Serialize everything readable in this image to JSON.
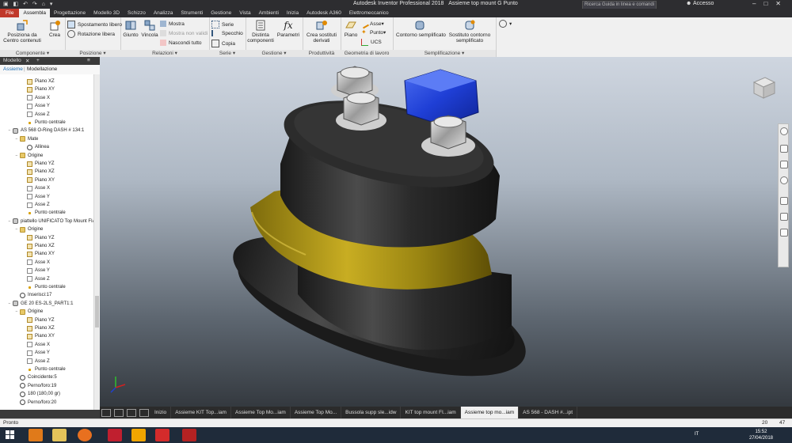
{
  "titlebar": {
    "app_title": "Autodesk Inventor Professional 2018",
    "doc_title": "Assieme top mount G Punto",
    "search_placeholder": "Ricerca Guida in linea e comandi",
    "account": "Accesso"
  },
  "tabs": [
    "File",
    "Assembla",
    "Progettazione",
    "Modello 3D",
    "Schizzo",
    "Analizza",
    "Strumenti",
    "Gestione",
    "Vista",
    "Ambienti",
    "Inizia",
    "Autodesk A360",
    "Elettromeccanico"
  ],
  "ribbon": {
    "componente": {
      "label": "Componente",
      "posiziona": "Posiziona da Centro contenuti",
      "crea": "Crea"
    },
    "posizione": {
      "label": "Posizione",
      "spostamento": "Spostamento libero",
      "rotazione": "Rotazione libera"
    },
    "relazioni": {
      "label": "Relazioni",
      "giunto": "Giunto",
      "vincola": "Vincola",
      "mostra": "Mostra",
      "mostra_non_validi": "Mostra non validi",
      "nascondi": "Nascondi tutto"
    },
    "serie": {
      "label": "Serie",
      "serie": "Serie",
      "specchio": "Specchio",
      "copia": "Copia"
    },
    "gestione": {
      "label": "Gestione",
      "distinta": "Distinta componenti",
      "parametri": "Parametri"
    },
    "produttivita": {
      "label": "Produttività",
      "crea_sostituti": "Crea sostituti derivati"
    },
    "geometria": {
      "label": "Geometria di lavoro",
      "piano": "Piano",
      "asse": "Asse",
      "punto": "Punto",
      "ucs": "UCS"
    },
    "semplificazione": {
      "label": "Semplificazione",
      "contorno": "Contorno semplificato",
      "sostituto": "Sostituto contorno semplificato"
    }
  },
  "browser": {
    "header": "Modello",
    "mode_assieme": "Assieme",
    "mode_modellazione": "Modellazione",
    "tree": [
      {
        "label": "Piano XZ",
        "indent": 3,
        "icon": "plane",
        "toggle": ""
      },
      {
        "label": "Piano XY",
        "indent": 3,
        "icon": "plane",
        "toggle": ""
      },
      {
        "label": "Asse X",
        "indent": 3,
        "icon": "axis",
        "toggle": ""
      },
      {
        "label": "Asse Y",
        "indent": 3,
        "icon": "axis",
        "toggle": ""
      },
      {
        "label": "Asse Z",
        "indent": 3,
        "icon": "axis",
        "toggle": ""
      },
      {
        "label": "Punto centrale",
        "indent": 3,
        "icon": "point",
        "toggle": ""
      },
      {
        "label": "AS 568 O-Ring DASH # 134:1",
        "indent": 1,
        "icon": "part",
        "toggle": "−"
      },
      {
        "label": "Mate",
        "indent": 2,
        "icon": "folder",
        "toggle": "−"
      },
      {
        "label": "Allinea",
        "indent": 3,
        "icon": "mate",
        "toggle": ""
      },
      {
        "label": "Origine",
        "indent": 2,
        "icon": "folder",
        "toggle": "−"
      },
      {
        "label": "Piano YZ",
        "indent": 3,
        "icon": "plane",
        "toggle": ""
      },
      {
        "label": "Piano XZ",
        "indent": 3,
        "icon": "plane",
        "toggle": ""
      },
      {
        "label": "Piano XY",
        "indent": 3,
        "icon": "plane",
        "toggle": ""
      },
      {
        "label": "Asse X",
        "indent": 3,
        "icon": "axis",
        "toggle": ""
      },
      {
        "label": "Asse Y",
        "indent": 3,
        "icon": "axis",
        "toggle": ""
      },
      {
        "label": "Asse Z",
        "indent": 3,
        "icon": "axis",
        "toggle": ""
      },
      {
        "label": "Punto centrale",
        "indent": 3,
        "icon": "point",
        "toggle": ""
      },
      {
        "label": "piattello UNIFICATO Top Mount FIAT G",
        "indent": 1,
        "icon": "part",
        "toggle": "−"
      },
      {
        "label": "Origine",
        "indent": 2,
        "icon": "folder",
        "toggle": "−"
      },
      {
        "label": "Piano YZ",
        "indent": 3,
        "icon": "plane",
        "toggle": ""
      },
      {
        "label": "Piano XZ",
        "indent": 3,
        "icon": "plane",
        "toggle": ""
      },
      {
        "label": "Piano XY",
        "indent": 3,
        "icon": "plane",
        "toggle": ""
      },
      {
        "label": "Asse X",
        "indent": 3,
        "icon": "axis",
        "toggle": ""
      },
      {
        "label": "Asse Y",
        "indent": 3,
        "icon": "axis",
        "toggle": ""
      },
      {
        "label": "Asse Z",
        "indent": 3,
        "icon": "axis",
        "toggle": ""
      },
      {
        "label": "Punto centrale",
        "indent": 3,
        "icon": "point",
        "toggle": ""
      },
      {
        "label": "Inserisci:17",
        "indent": 2,
        "icon": "mate",
        "toggle": ""
      },
      {
        "label": "GE 20 ES-2LS_PART1:1",
        "indent": 1,
        "icon": "part",
        "toggle": "−"
      },
      {
        "label": "Origine",
        "indent": 2,
        "icon": "folder",
        "toggle": "−"
      },
      {
        "label": "Piano YZ",
        "indent": 3,
        "icon": "plane",
        "toggle": ""
      },
      {
        "label": "Piano XZ",
        "indent": 3,
        "icon": "plane",
        "toggle": ""
      },
      {
        "label": "Piano XY",
        "indent": 3,
        "icon": "plane",
        "toggle": ""
      },
      {
        "label": "Asse X",
        "indent": 3,
        "icon": "axis",
        "toggle": ""
      },
      {
        "label": "Asse Y",
        "indent": 3,
        "icon": "axis",
        "toggle": ""
      },
      {
        "label": "Asse Z",
        "indent": 3,
        "icon": "axis",
        "toggle": ""
      },
      {
        "label": "Punto centrale",
        "indent": 3,
        "icon": "point",
        "toggle": ""
      },
      {
        "label": "Coincidente:5",
        "indent": 2,
        "icon": "mate",
        "toggle": ""
      },
      {
        "label": "Perno/foro:19",
        "indent": 2,
        "icon": "mate",
        "toggle": ""
      },
      {
        "label": "180 (180,00 gr)",
        "indent": 2,
        "icon": "mate",
        "toggle": ""
      },
      {
        "label": "Perno/foro:20",
        "indent": 2,
        "icon": "mate",
        "toggle": ""
      }
    ]
  },
  "doc_tabs": [
    "Inizio",
    "Assieme KIT Top...iam",
    "Assieme Top Mo...iam",
    "Assieme Top Mo...",
    "Bussola supp sle...idw",
    "KIT top mount FI...iam",
    "Assieme top mo...iam",
    "AS 568 - DASH #...ipt"
  ],
  "active_doc_tab_index": 6,
  "status": {
    "text": "Pronto",
    "count1": "20",
    "count2": "47"
  },
  "taskbar": {
    "lang": "IT",
    "time": "15:52",
    "date": "27/04/2018"
  },
  "colors": {
    "accent_file": "#c0392b",
    "nut_blue": "#1f3fd6",
    "rubber_yellow": "#b39a1a",
    "body_dark": "#2a2a2a"
  }
}
